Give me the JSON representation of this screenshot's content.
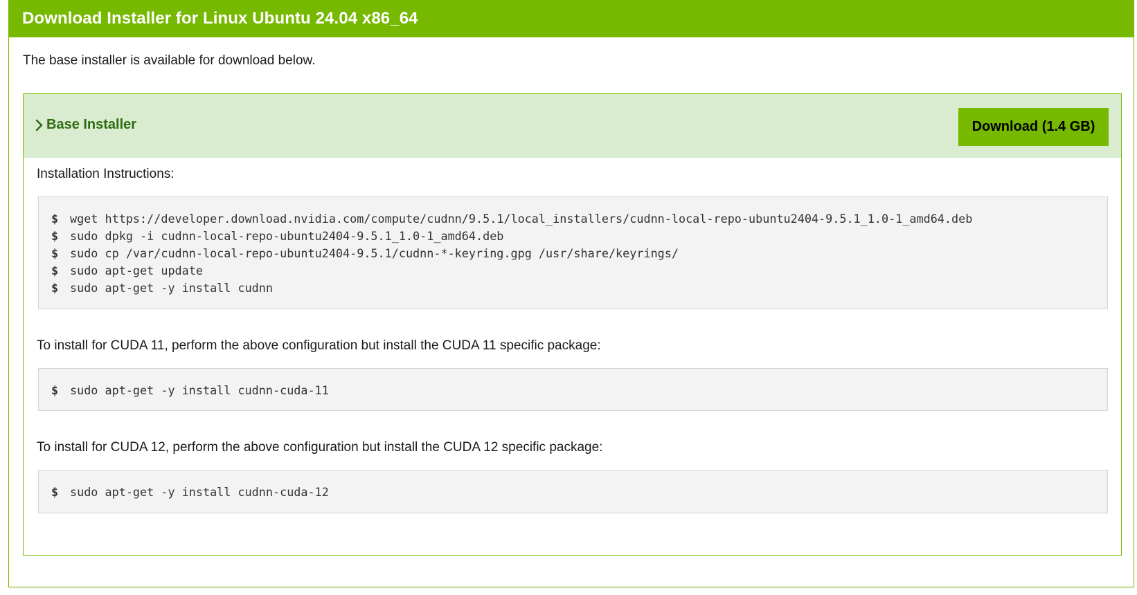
{
  "header": {
    "title": "Download Installer for Linux Ubuntu 24.04 x86_64"
  },
  "intro_text": "The base installer is available for download below.",
  "installer": {
    "title": "Base Installer",
    "download_label": "Download (1.4 GB)",
    "instructions_label": "Installation Instructions:",
    "commands": [
      "wget https://developer.download.nvidia.com/compute/cudnn/9.5.1/local_installers/cudnn-local-repo-ubuntu2404-9.5.1_1.0-1_amd64.deb",
      "sudo dpkg -i cudnn-local-repo-ubuntu2404-9.5.1_1.0-1_amd64.deb",
      "sudo cp /var/cudnn-local-repo-ubuntu2404-9.5.1/cudnn-*-keyring.gpg /usr/share/keyrings/",
      "sudo apt-get update",
      "sudo apt-get -y install cudnn"
    ],
    "cuda11_label": "To install for CUDA 11, perform the above configuration but install the CUDA 11 specific package:",
    "cuda11_command": "sudo apt-get -y install cudnn-cuda-11",
    "cuda12_label": "To install for CUDA 12, perform the above configuration but install the CUDA 12 specific package:",
    "cuda12_command": "sudo apt-get -y install cudnn-cuda-12",
    "prompt_symbol": "$"
  },
  "colors": {
    "brand_green": "#76b900",
    "installer_header_bg": "#d9ecd0",
    "installer_title": "#2f6b10",
    "code_bg": "#f3f3f3"
  },
  "icons": {
    "expand": "chevron-right-icon"
  }
}
